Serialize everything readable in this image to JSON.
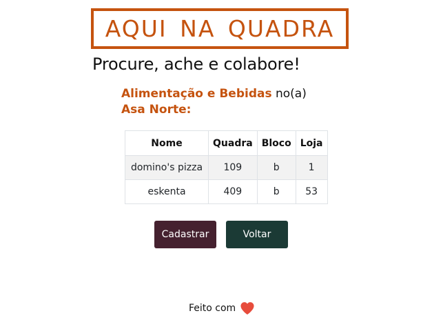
{
  "header": {
    "logo_text": "AQUI  NA  QUADRA",
    "tagline": "Procure, ache e colabore!"
  },
  "heading": {
    "category": "Alimentação e Bebidas",
    "connector": "no(a)",
    "region": "Asa Norte:"
  },
  "table": {
    "columns": [
      "Nome",
      "Quadra",
      "Bloco",
      "Loja"
    ],
    "rows": [
      [
        "domino's pizza",
        "109",
        "b",
        "1"
      ],
      [
        "eskenta",
        "409",
        "b",
        "53"
      ]
    ]
  },
  "actions": {
    "register_label": "Cadastrar",
    "back_label": "Voltar"
  },
  "footer": {
    "made_with": "Feito com",
    "icon": "heart-icon"
  },
  "colors": {
    "brand": "#c5530f",
    "register_button": "#45212f",
    "back_button": "#1b3a35",
    "heart": "#e74c3c"
  }
}
